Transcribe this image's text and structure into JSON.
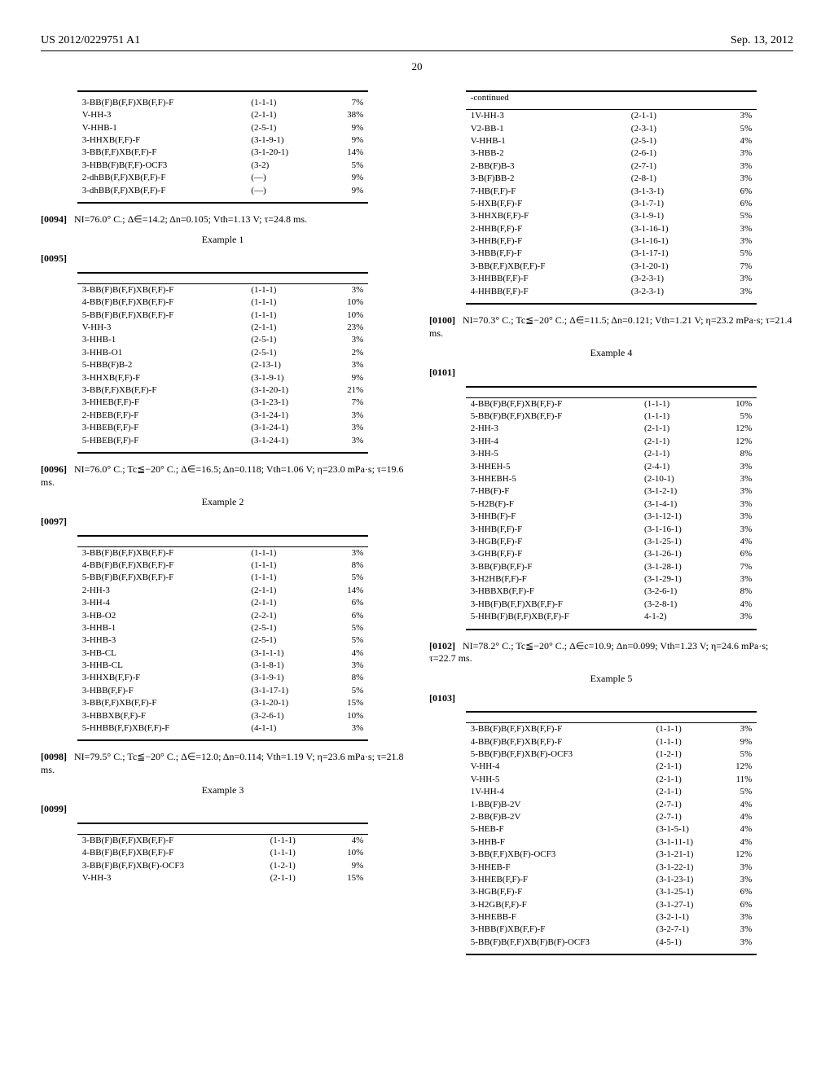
{
  "header": {
    "left": "US 2012/0229751 A1",
    "right": "Sep. 13, 2012"
  },
  "page_number": "20",
  "tables": {
    "t0": [
      [
        "3-BB(F)B(F,F)XB(F,F)-F",
        "(1-1-1)",
        "7%"
      ],
      [
        "V-HH-3",
        "(2-1-1)",
        "38%"
      ],
      [
        "V-HHB-1",
        "(2-5-1)",
        "9%"
      ],
      [
        "3-HHXB(F,F)-F",
        "(3-1-9-1)",
        "9%"
      ],
      [
        "3-BB(F,F)XB(F,F)-F",
        "(3-1-20-1)",
        "14%"
      ],
      [
        "3-HBB(F)B(F,F)-OCF3",
        "(3-2)",
        "5%"
      ],
      [
        "2-dhBB(F,F)XB(F,F)-F",
        "(—)",
        "9%"
      ],
      [
        "3-dhBB(F,F)XB(F,F)-F",
        "(—)",
        "9%"
      ]
    ],
    "t1": [
      [
        "3-BB(F)B(F,F)XB(F,F)-F",
        "(1-1-1)",
        "3%"
      ],
      [
        "4-BB(F)B(F,F)XB(F,F)-F",
        "(1-1-1)",
        "10%"
      ],
      [
        "5-BB(F)B(F,F)XB(F,F)-F",
        "(1-1-1)",
        "10%"
      ],
      [
        "V-HH-3",
        "(2-1-1)",
        "23%"
      ],
      [
        "3-HHB-1",
        "(2-5-1)",
        "3%"
      ],
      [
        "3-HHB-O1",
        "(2-5-1)",
        "2%"
      ],
      [
        "5-HBB(F)B-2",
        "(2-13-1)",
        "3%"
      ],
      [
        "3-HHXB(F,F)-F",
        "(3-1-9-1)",
        "9%"
      ],
      [
        "3-BB(F,F)XB(F,F)-F",
        "(3-1-20-1)",
        "21%"
      ],
      [
        "3-HHEB(F,F)-F",
        "(3-1-23-1)",
        "7%"
      ],
      [
        "2-HBEB(F,F)-F",
        "(3-1-24-1)",
        "3%"
      ],
      [
        "3-HBEB(F,F)-F",
        "(3-1-24-1)",
        "3%"
      ],
      [
        "5-HBEB(F,F)-F",
        "(3-1-24-1)",
        "3%"
      ]
    ],
    "t2": [
      [
        "3-BB(F)B(F,F)XB(F,F)-F",
        "(1-1-1)",
        "3%"
      ],
      [
        "4-BB(F)B(F,F)XB(F,F)-F",
        "(1-1-1)",
        "8%"
      ],
      [
        "5-BB(F)B(F,F)XB(F,F)-F",
        "(1-1-1)",
        "5%"
      ],
      [
        "2-HH-3",
        "(2-1-1)",
        "14%"
      ],
      [
        "3-HH-4",
        "(2-1-1)",
        "6%"
      ],
      [
        "3-HB-O2",
        "(2-2-1)",
        "6%"
      ],
      [
        "3-HHB-1",
        "(2-5-1)",
        "5%"
      ],
      [
        "3-HHB-3",
        "(2-5-1)",
        "5%"
      ],
      [
        "3-HB-CL",
        "(3-1-1-1)",
        "4%"
      ],
      [
        "3-HHB-CL",
        "(3-1-8-1)",
        "3%"
      ],
      [
        "3-HHXB(F,F)-F",
        "(3-1-9-1)",
        "8%"
      ],
      [
        "3-HBB(F,F)-F",
        "(3-1-17-1)",
        "5%"
      ],
      [
        "3-BB(F,F)XB(F,F)-F",
        "(3-1-20-1)",
        "15%"
      ],
      [
        "3-HBBXB(F,F)-F",
        "(3-2-6-1)",
        "10%"
      ],
      [
        "5-HHBB(F,F)XB(F,F)-F",
        "(4-1-1)",
        "3%"
      ]
    ],
    "t3a": [
      [
        "3-BB(F)B(F,F)XB(F,F)-F",
        "(1-1-1)",
        "4%"
      ],
      [
        "4-BB(F)B(F,F)XB(F,F)-F",
        "(1-1-1)",
        "10%"
      ],
      [
        "3-BB(F)B(F,F)XB(F)-OCF3",
        "(1-2-1)",
        "9%"
      ],
      [
        "V-HH-3",
        "(2-1-1)",
        "15%"
      ]
    ],
    "t3b": [
      [
        "1V-HH-3",
        "(2-1-1)",
        "3%"
      ],
      [
        "V2-BB-1",
        "(2-3-1)",
        "5%"
      ],
      [
        "V-HHB-1",
        "(2-5-1)",
        "4%"
      ],
      [
        "3-HBB-2",
        "(2-6-1)",
        "3%"
      ],
      [
        "2-BB(F)B-3",
        "(2-7-1)",
        "3%"
      ],
      [
        "3-B(F)BB-2",
        "(2-8-1)",
        "3%"
      ],
      [
        "7-HB(F,F)-F",
        "(3-1-3-1)",
        "6%"
      ],
      [
        "5-HXB(F,F)-F",
        "(3-1-7-1)",
        "6%"
      ],
      [
        "3-HHXB(F,F)-F",
        "(3-1-9-1)",
        "5%"
      ],
      [
        "2-HHB(F,F)-F",
        "(3-1-16-1)",
        "3%"
      ],
      [
        "3-HHB(F,F)-F",
        "(3-1-16-1)",
        "3%"
      ],
      [
        "3-HBB(F,F)-F",
        "(3-1-17-1)",
        "5%"
      ],
      [
        "3-BB(F,F)XB(F,F)-F",
        "(3-1-20-1)",
        "7%"
      ],
      [
        "3-HHBB(F,F)-F",
        "(3-2-3-1)",
        "3%"
      ],
      [
        "4-HHBB(F,F)-F",
        "(3-2-3-1)",
        "3%"
      ]
    ],
    "t4": [
      [
        "4-BB(F)B(F,F)XB(F,F)-F",
        "(1-1-1)",
        "10%"
      ],
      [
        "5-BB(F)B(F,F)XB(F,F)-F",
        "(1-1-1)",
        "5%"
      ],
      [
        "2-HH-3",
        "(2-1-1)",
        "12%"
      ],
      [
        "3-HH-4",
        "(2-1-1)",
        "12%"
      ],
      [
        "3-HH-5",
        "(2-1-1)",
        "8%"
      ],
      [
        "3-HHEH-5",
        "(2-4-1)",
        "3%"
      ],
      [
        "3-HHEBH-5",
        "(2-10-1)",
        "3%"
      ],
      [
        "7-HB(F)-F",
        "(3-1-2-1)",
        "3%"
      ],
      [
        "5-H2B(F)-F",
        "(3-1-4-1)",
        "3%"
      ],
      [
        "3-HHB(F)-F",
        "(3-1-12-1)",
        "3%"
      ],
      [
        "3-HHB(F,F)-F",
        "(3-1-16-1)",
        "3%"
      ],
      [
        "3-HGB(F,F)-F",
        "(3-1-25-1)",
        "4%"
      ],
      [
        "3-GHB(F,F)-F",
        "(3-1-26-1)",
        "6%"
      ],
      [
        "3-BB(F)B(F,F)-F",
        "(3-1-28-1)",
        "7%"
      ],
      [
        "3-H2HB(F,F)-F",
        "(3-1-29-1)",
        "3%"
      ],
      [
        "3-HBBXB(F,F)-F",
        "(3-2-6-1)",
        "8%"
      ],
      [
        "3-HB(F)B(F,F)XB(F,F)-F",
        "(3-2-8-1)",
        "4%"
      ],
      [
        "5-HHB(F)B(F,F)XB(F,F)-F",
        "4-1-2)",
        "3%"
      ]
    ],
    "t5": [
      [
        "3-BB(F)B(F,F)XB(F,F)-F",
        "(1-1-1)",
        "3%"
      ],
      [
        "4-BB(F)B(F,F)XB(F,F)-F",
        "(1-1-1)",
        "9%"
      ],
      [
        "5-BB(F)B(F,F)XB(F)-OCF3",
        "(1-2-1)",
        "5%"
      ],
      [
        "V-HH-4",
        "(2-1-1)",
        "12%"
      ],
      [
        "V-HH-5",
        "(2-1-1)",
        "11%"
      ],
      [
        "1V-HH-4",
        "(2-1-1)",
        "5%"
      ],
      [
        "1-BB(F)B-2V",
        "(2-7-1)",
        "4%"
      ],
      [
        "2-BB(F)B-2V",
        "(2-7-1)",
        "4%"
      ],
      [
        "5-HEB-F",
        "(3-1-5-1)",
        "4%"
      ],
      [
        "3-HHB-F",
        "(3-1-11-1)",
        "4%"
      ],
      [
        "3-BB(F,F)XB(F)-OCF3",
        "(3-1-21-1)",
        "12%"
      ],
      [
        "3-HHEB-F",
        "(3-1-22-1)",
        "3%"
      ],
      [
        "3-HHEB(F,F)-F",
        "(3-1-23-1)",
        "3%"
      ],
      [
        "3-HGB(F,F)-F",
        "(3-1-25-1)",
        "6%"
      ],
      [
        "3-H2GB(F,F)-F",
        "(3-1-27-1)",
        "6%"
      ],
      [
        "3-HHEBB-F",
        "(3-2-1-1)",
        "3%"
      ],
      [
        "3-HBB(F)XB(F,F)-F",
        "(3-2-7-1)",
        "3%"
      ],
      [
        "5-BB(F)B(F,F)XB(F)B(F)-OCF3",
        "(4-5-1)",
        "3%"
      ]
    ]
  },
  "paras": {
    "p0094": "NI=76.0° C.; Δ∈=14.2; Δn=0.105; Vth=1.13 V; τ=24.8 ms.",
    "p0096": "NI=76.0° C.; Tc≦−20° C.; Δ∈=16.5; Δn=0.118; Vth=1.06 V; η=23.0 mPa·s; τ=19.6 ms.",
    "p0098": "NI=79.5° C.; Tc≦−20° C.; Δ∈=12.0; Δn=0.114; Vth=1.19 V; η=23.6 mPa·s; τ=21.8 ms.",
    "p0100": "NI=70.3° C.; Tc≦−20° C.; Δ∈=11.5; Δn=0.121; Vth=1.21 V; η=23.2 mPa·s; τ=21.4 ms.",
    "p0102": "NI=78.2° C.; Tc≦−20° C.; Δ∈c=10.9; Δn=0.099; Vth=1.23 V; η=24.6 mPa·s; τ=22.7 ms."
  },
  "labels": {
    "example1": "Example 1",
    "example2": "Example 2",
    "example3": "Example 3",
    "example4": "Example 4",
    "example5": "Example 5",
    "continued": "-continued",
    "n0094": "[0094]",
    "n0095": "[0095]",
    "n0096": "[0096]",
    "n0097": "[0097]",
    "n0098": "[0098]",
    "n0099": "[0099]",
    "n0100": "[0100]",
    "n0101": "[0101]",
    "n0102": "[0102]",
    "n0103": "[0103]"
  }
}
